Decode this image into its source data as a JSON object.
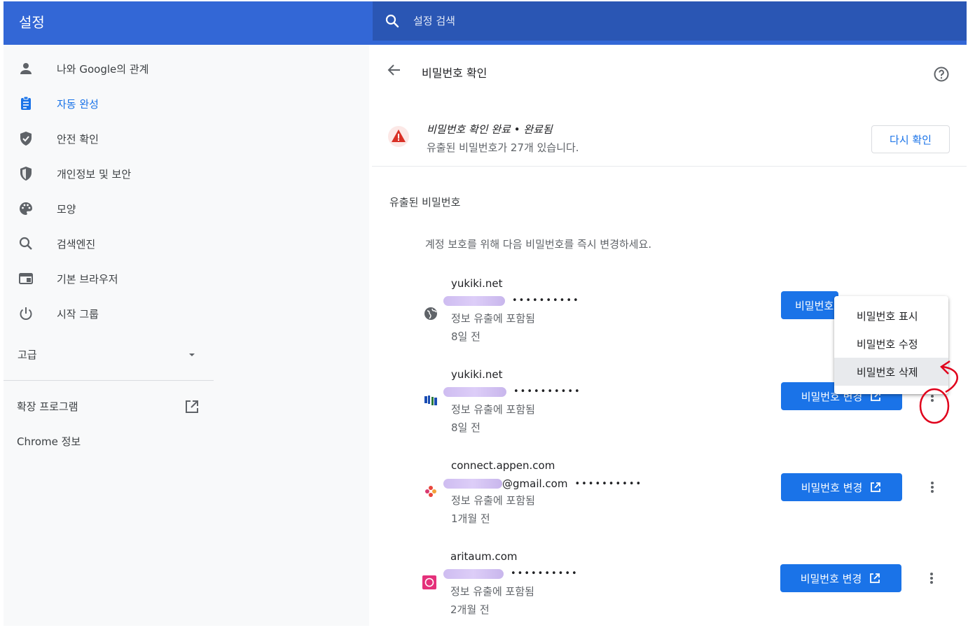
{
  "header": {
    "title": "설정"
  },
  "search": {
    "placeholder": "설정 검색"
  },
  "sidebar": {
    "items": [
      {
        "label": "나와 Google의 관계",
        "icon": "person-icon"
      },
      {
        "label": "자동 완성",
        "icon": "clipboard-icon",
        "active": true
      },
      {
        "label": "안전 확인",
        "icon": "shield-check-icon"
      },
      {
        "label": "개인정보 및 보안",
        "icon": "shield-icon"
      },
      {
        "label": "모양",
        "icon": "palette-icon"
      },
      {
        "label": "검색엔진",
        "icon": "search-icon"
      },
      {
        "label": "기본 브라우저",
        "icon": "browser-icon"
      },
      {
        "label": "시작 그룹",
        "icon": "power-icon"
      }
    ],
    "advanced_label": "고급",
    "extensions_label": "확장 프로그램",
    "about_label": "Chrome 정보"
  },
  "page": {
    "title": "비밀번호 확인",
    "status": {
      "title": "비밀번호 확인 완료 • 완료됨",
      "description": "유출된 비밀번호가 27개 있습니다.",
      "recheck_label": "다시 확인"
    },
    "section_title": "유출된 비밀번호",
    "section_desc": "계정 보호를 위해 다음 비밀번호를 즉시 변경하세요.",
    "credentials": [
      {
        "site": "yukiki.net",
        "username_suffix": "",
        "password_mask": "••••••••••",
        "leak": "정보 유출에 포함됨",
        "when": "8일 전",
        "icon": "globe-icon"
      },
      {
        "site": "yukiki.net",
        "username_suffix": "",
        "password_mask": "••••••••••",
        "leak": "정보 유출에 포함됨",
        "when": "8일 전",
        "icon": "site-favicon-icon"
      },
      {
        "site": "connect.appen.com",
        "username_suffix": "@gmail.com",
        "password_mask": "••••••••••",
        "leak": "정보 유출에 포함됨",
        "when": "1개월 전",
        "icon": "appen-favicon-icon"
      },
      {
        "site": "aritaum.com",
        "username_suffix": "",
        "password_mask": "••••••••••",
        "leak": "정보 유출에 포함됨",
        "when": "2개월 전",
        "icon": "aritaum-favicon-icon"
      }
    ],
    "change_label": "비밀번호 변경",
    "change_label_truncated": "비밀번호"
  },
  "menu": {
    "items": [
      "비밀번호 표시",
      "비밀번호 수정",
      "비밀번호 삭제"
    ]
  },
  "colors": {
    "brand": "#3367d6",
    "accent": "#1a73e8",
    "warning": "#d93025",
    "annotation": "#e0001b"
  }
}
